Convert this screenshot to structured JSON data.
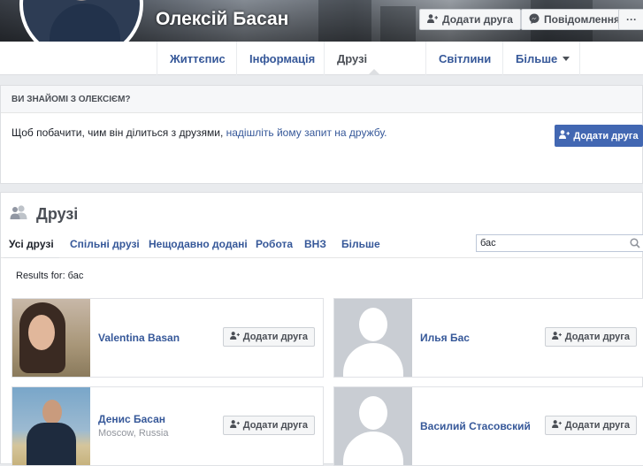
{
  "profile": {
    "name": "Олексій Басан",
    "add_friend_label": "Додати друга",
    "message_label": "Повідомлення",
    "more_dots": "···"
  },
  "nav": {
    "items": [
      "Життєпис",
      "Інформація",
      "Друзі",
      "Світлини",
      "Більше"
    ]
  },
  "notice": {
    "heading": "ВИ ЗНАЙОМІ З ОЛЕКСІЄМ?",
    "text": "Щоб побачити, чим він ділиться з друзями, ",
    "link": "надішліть йому запит на дружбу.",
    "button": "Додати друга"
  },
  "friends": {
    "title": "Друзі",
    "tabs": [
      "Усі друзі",
      "Спільні друзі",
      "Нещодавно додані",
      "Робота",
      "ВНЗ",
      "Більше"
    ],
    "search_value": "бас",
    "results_label": "Results for: бас",
    "add_label": "Додати друга",
    "cards": [
      {
        "name": "Valentina Basan",
        "sub": ""
      },
      {
        "name": "Илья Бас",
        "sub": ""
      },
      {
        "name": "Денис Басан",
        "sub": "Moscow, Russia"
      },
      {
        "name": "Василий Стасовский",
        "sub": ""
      }
    ]
  },
  "colors": {
    "link": "#365899",
    "primary_button": "#4267b2",
    "background": "#e9ebee"
  }
}
